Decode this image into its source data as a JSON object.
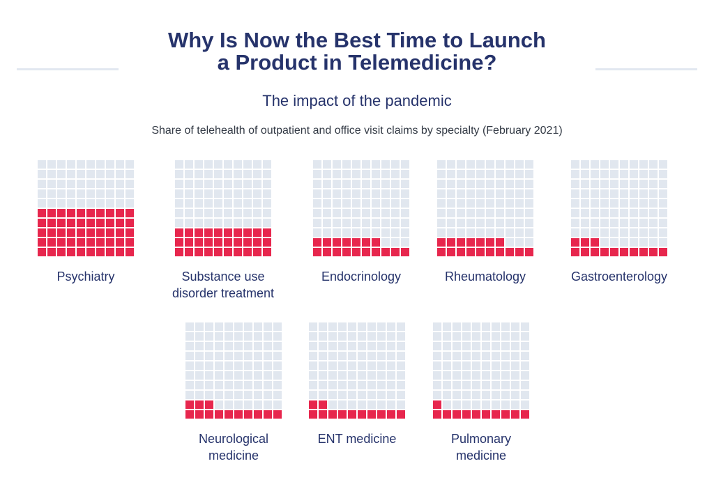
{
  "header": {
    "title_line1": "Why Is Now the Best Time to Launch",
    "title_line2": "a Product in Telemedicine?",
    "subtitle": "The impact of the pandemic",
    "caption": "Share of telehealth of outpatient and office visit claims by specialty (February 2021)"
  },
  "colors": {
    "filled": "#e7264d",
    "empty": "#e1e7ef",
    "text": "#26336b"
  },
  "chart_data": {
    "type": "waffle",
    "title": "Share of telehealth of outpatient and office visit claims by specialty (February 2021)",
    "unit": "percent (each square = 1%)",
    "grid": "10x10",
    "categories": [
      "Psychiatry",
      "Substance use disorder treatment",
      "Endocrinology",
      "Rheumatology",
      "Gastroenterology",
      "Neurological medicine",
      "ENT medicine",
      "Pulmonary medicine"
    ],
    "values": [
      50,
      30,
      17,
      17,
      13,
      13,
      12,
      11
    ],
    "labels": [
      [
        "Psychiatry"
      ],
      [
        "Substance use",
        "disorder treatment"
      ],
      [
        "Endocrinology"
      ],
      [
        "Rheumatology"
      ],
      [
        "Gastroenterology"
      ],
      [
        "Neurological",
        "medicine"
      ],
      [
        "ENT medicine"
      ],
      [
        "Pulmonary",
        "medicine"
      ]
    ]
  }
}
